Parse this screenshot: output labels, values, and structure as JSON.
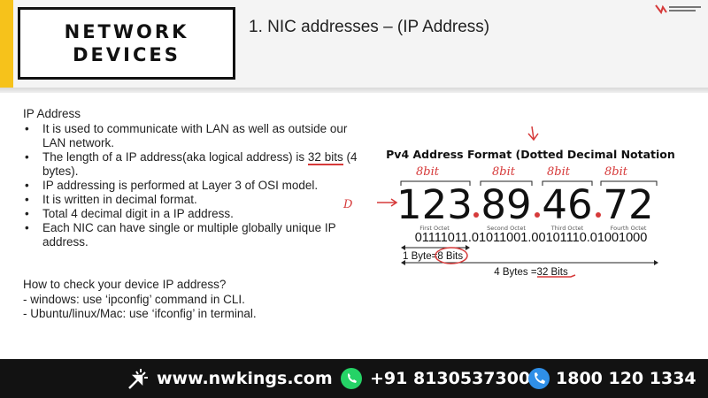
{
  "header": {
    "badge_line1": "NETWORK",
    "badge_line2": "DEVICES",
    "title": "1. NIC addresses – (IP Address)"
  },
  "content": {
    "heading": "IP Address",
    "bullets": [
      "It is used to communicate with LAN as well as outside our LAN network.",
      "The length of a IP address(aka logical address) is 32 bits (4 bytes).",
      "IP addressing is performed at Layer 3 of OSI model.",
      "It is written in decimal format.",
      "Total 4 decimal digit in a IP address.",
      "Each NIC can have single or multiple globally unique IP address."
    ],
    "bullet2_parts": [
      "The length of a IP address(aka logical address) is ",
      "32 bits",
      " (4 bytes)."
    ],
    "howto": [
      "How to check your device IP address?",
      "- windows: use ‘ipconfig’ command in CLI.",
      "- Ubuntu/linux/Mac: use ‘ifconfig’ in terminal."
    ]
  },
  "diagram": {
    "title": "IPv4 Address Format (Dotted Decimal Notation)",
    "octets": [
      "123",
      "89",
      "46",
      "72"
    ],
    "octet_labels": [
      "First Octet",
      "Second Octet",
      "Third Octet",
      "Fourth Octet"
    ],
    "binary": "01111011.01011001.00101110.01001000",
    "byte_label": "1 Byte=8 Bits",
    "bytes_label": "4 Bytes =32 Bits",
    "handwritten": [
      "8bit",
      "8bit",
      "8bit",
      "8bit"
    ],
    "handwritten_left": "D"
  },
  "footer": {
    "website": "www.nwkings.com",
    "whatsapp": "+91 8130537300",
    "phone": "1800 120 1334"
  },
  "colors": {
    "accent_yellow": "#f6c21b",
    "ink_red": "#d63a3a",
    "footer_bg": "#121212",
    "whatsapp_green": "#25d366",
    "phone_blue": "#2f8fe8"
  },
  "icons": [
    "cursor-click-icon",
    "whatsapp-icon",
    "phone-icon",
    "brand-logo"
  ]
}
